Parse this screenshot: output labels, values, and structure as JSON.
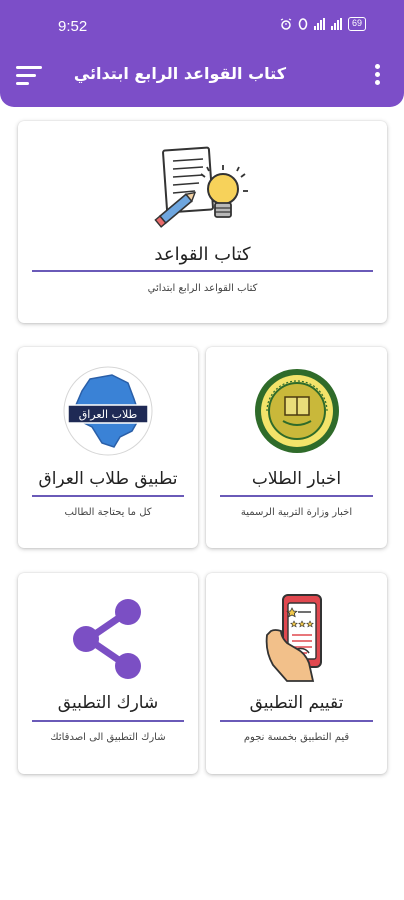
{
  "status_bar": {
    "time": "9:52",
    "icons": [
      "alarm-icon",
      "hotspot-icon",
      "signal-icon",
      "signal-icon",
      "battery-icon"
    ],
    "battery_label": "69"
  },
  "app_bar": {
    "title": "كتاب القواعد الرابع ابتدائي",
    "menu_icon": "hamburger-menu-icon",
    "more_icon": "more-vertical-icon"
  },
  "cards": {
    "rules_book": {
      "title": "كتاب القواعد",
      "subtitle": "كتاب القواعد الرابع ابتدائي",
      "icon": "paper-pencil-lightbulb-icon"
    },
    "student_news": {
      "title": "اخبار الطلاب",
      "subtitle": "اخبار وزارة التربية الرسمية",
      "icon": "ministry-seal-logo"
    },
    "iraq_students_app": {
      "title": "تطبيق طلاب العراق",
      "subtitle": "كل ما يحتاجة الطالب",
      "icon": "iraq-map-logo",
      "logo_text": "طلاب العراق"
    },
    "rate_app": {
      "title": "تقييم التطبيق",
      "subtitle": "قيم التطبيق بخمسة نجوم",
      "icon": "phone-rating-icon"
    },
    "share_app": {
      "title": "شارك التطبيق",
      "subtitle": "شارك التطبيق الى اصدقائك",
      "icon": "share-icon"
    }
  },
  "colors": {
    "primary": "#7c4ec8",
    "title_underline": "#6a5ab8",
    "share_icon": "#7b4fc4"
  }
}
